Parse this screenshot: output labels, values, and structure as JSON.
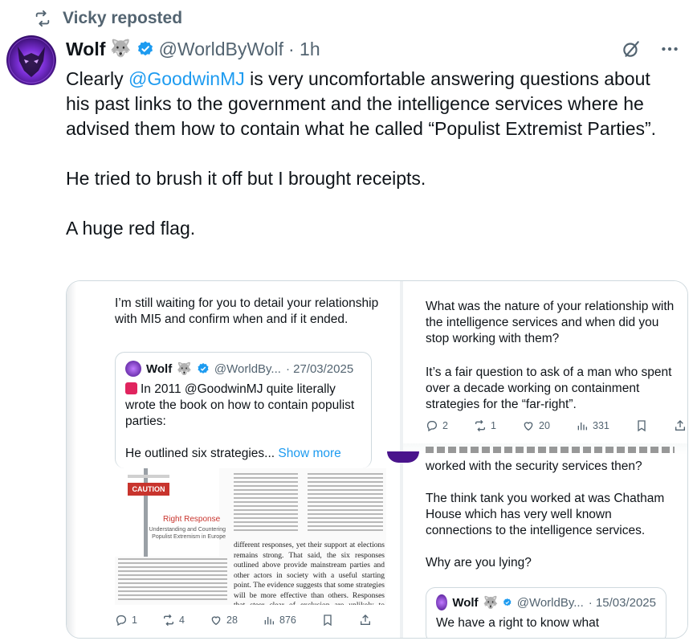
{
  "repost": {
    "label": "Vicky reposted",
    "icon": "repost-icon"
  },
  "tweet": {
    "author_name": "Wolf",
    "author_emoji": "🐺",
    "handle": "@WorldByWolf",
    "dot_time": "· 1h",
    "text_part1": "Clearly ",
    "mention": "@GoodwinMJ",
    "text_part2": " is very uncomfortable answering questions about his past links to the government and the intelligence services where he advised them how to contain what he called “Populist Extremist Parties”.\n\nHe tried to brush it off but I brought receipts.\n\nA huge red flag."
  },
  "media_left": {
    "text": "I’m still waiting for you to detail your relationship with MI5 and confirm when and if it ended.",
    "quote": {
      "name": "Wolf",
      "emoji": "🐺",
      "handle": "@WorldBy...",
      "date": "· 27/03/2025",
      "text": "In 2011 @GoodwinMJ quite literally wrote the book on how to contain populist parties:\n\nHe outlined six strategies...",
      "show_more": " Show more"
    },
    "book": {
      "caution": "CAUTION",
      "title": "Right Response",
      "subtitle": "Understanding and Countering Populist Extremism in Europe",
      "paragraph": "different responses, yet their support at elections remains strong. That said, the six responses outlined above provide mainstream parties and other actors in society with a useful starting point. The evidence suggests that some strategies will be more effective than others. Responses that steer clear of exclusion are unlikely to encourage the further radicalization of PEPs and their most committed supporters."
    },
    "stats": {
      "replies": "1",
      "reposts": "4",
      "likes": "28",
      "views": "876"
    }
  },
  "media_right": {
    "text1": "What was the nature of your relationship with the intelligence services and when did you stop working with them?",
    "text2": "It’s a fair question to ask of a man who spent over a decade working on containment strategies for the “far-right”.",
    "stats": {
      "replies": "2",
      "reposts": "1",
      "likes": "20",
      "views": "331"
    },
    "text3": "worked with the security services then?\n\nThe think tank you worked at was Chatham House which has very well known connections to the intelligence services.\n\nWhy are you lying?",
    "quote": {
      "name": "Wolf",
      "emoji": "🐺",
      "handle": "@WorldBy...",
      "date": "· 15/03/2025",
      "text": "We have a right to know what"
    }
  },
  "colors": {
    "link": "#1d9bf0",
    "verified": "#1d9bf0",
    "muted": "#536471",
    "caution": "#c8342d"
  }
}
